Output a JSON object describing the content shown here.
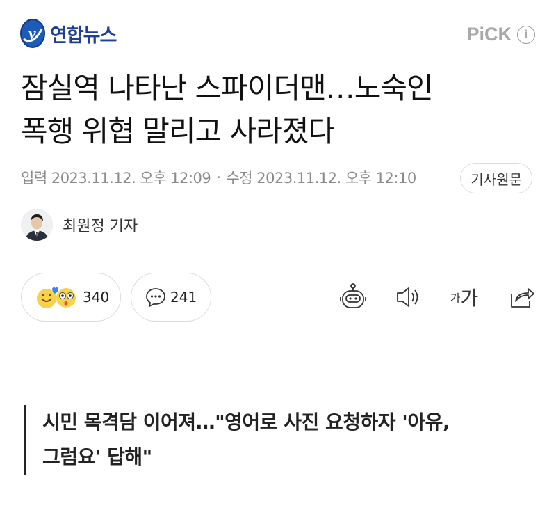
{
  "header": {
    "logo_text": "연합뉴스",
    "pick_label": "PiCK",
    "info_symbol": "i"
  },
  "article": {
    "title_line1": "잠실역 나타난 스파이더맨…노숙인",
    "title_line2": "폭행 위협 말리고 사라졌다",
    "input_label": "입력",
    "input_date": "2023.11.12. 오후 12:09",
    "meta_separator": "·",
    "modified_label": "수정",
    "modified_date": "2023.11.12. 오후 12:10",
    "original_button": "기사원문",
    "reporter": "최원정 기자",
    "subtitle_line1": "시민 목격담 이어져…\"영어로 사진 요청하자 '아유,",
    "subtitle_line2": "그럼요' 답해\""
  },
  "actions": {
    "reaction_count": "340",
    "comment_count": "241",
    "font_small_glyph": "가",
    "font_large_glyph": "가",
    "icons": [
      "reaction-emoji-icon",
      "comment-bubble-icon",
      "summary-bot-icon",
      "speaker-icon",
      "font-size-icon",
      "share-icon"
    ]
  },
  "colors": {
    "brand_blue": "#1e3f94",
    "muted_gray": "#8a8a8a",
    "border_gray": "#dcdcdc"
  }
}
